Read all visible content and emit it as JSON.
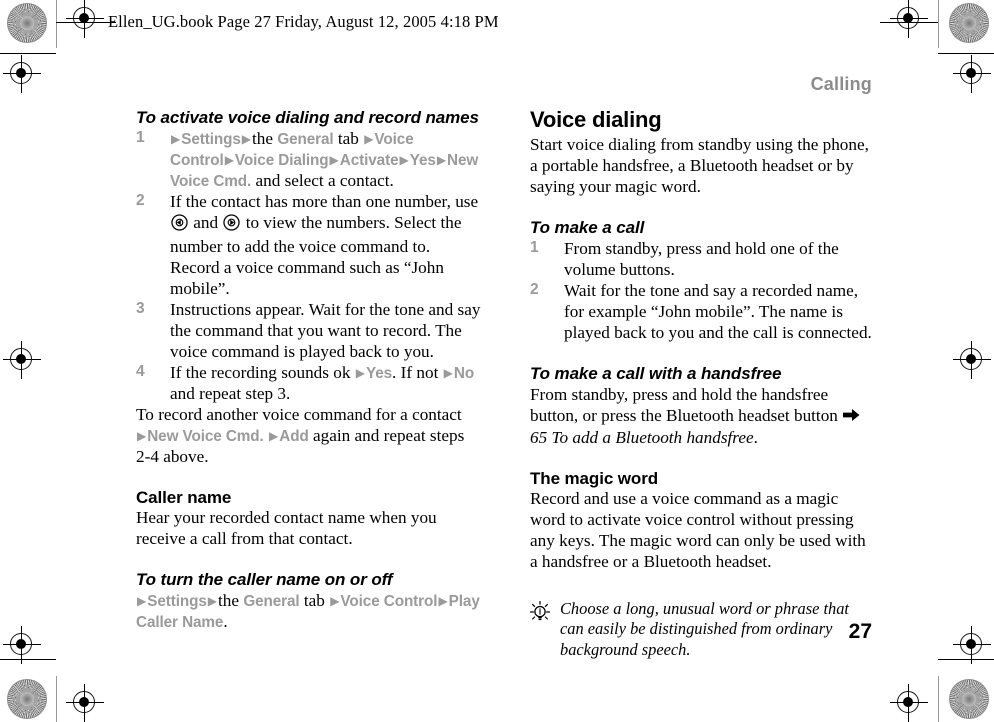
{
  "print_slug": "Ellen_UG.book  Page 27  Friday, August 12, 2005  4:18 PM",
  "running_head": "Calling",
  "page_number": "27",
  "colors": {
    "menu_gray": "#9a9a9a",
    "runhead_gray": "#8c8c8c",
    "text_black": "#000000"
  },
  "left_column": {
    "procedure_1": {
      "heading": "To activate voice dialing and record names",
      "steps": [
        {
          "number": "1",
          "segments": [
            {
              "type": "arrow"
            },
            {
              "type": "menu",
              "text": "Settings"
            },
            {
              "type": "arrow"
            },
            {
              "type": "text",
              "text": "the "
            },
            {
              "type": "menu",
              "text": "General"
            },
            {
              "type": "text",
              "text": " tab "
            },
            {
              "type": "arrow"
            },
            {
              "type": "menu",
              "text": "Voice Control"
            },
            {
              "type": "arrow"
            },
            {
              "type": "menu",
              "text": "Voice Dialing"
            },
            {
              "type": "arrow"
            },
            {
              "type": "menu",
              "text": "Activate"
            },
            {
              "type": "arrow"
            },
            {
              "type": "menu",
              "text": "Yes"
            },
            {
              "type": "arrow"
            },
            {
              "type": "menu",
              "text": "New Voice Cmd."
            },
            {
              "type": "text",
              "text": " and select a contact."
            }
          ]
        },
        {
          "number": "2",
          "segments": [
            {
              "type": "text",
              "text": "If the contact has more than one number, use "
            },
            {
              "type": "navkey",
              "direction": "left"
            },
            {
              "type": "text",
              "text": " and "
            },
            {
              "type": "navkey",
              "direction": "right"
            },
            {
              "type": "text",
              "text": " to view the numbers. Select the number to add the voice command to. Record a voice command such as “John mobile”."
            }
          ]
        },
        {
          "number": "3",
          "segments": [
            {
              "type": "text",
              "text": "Instructions appear. Wait for the tone and say the command that you want to record. The voice command is played back to you."
            }
          ]
        },
        {
          "number": "4",
          "segments": [
            {
              "type": "text",
              "text": "If the recording sounds ok "
            },
            {
              "type": "arrow"
            },
            {
              "type": "menu",
              "text": "Yes"
            },
            {
              "type": "text",
              "text": ". If not "
            },
            {
              "type": "arrow"
            },
            {
              "type": "menu",
              "text": "No"
            },
            {
              "type": "text",
              "text": " and repeat step 3."
            }
          ]
        }
      ],
      "closing_paragraph": [
        {
          "type": "text",
          "text": "To record another voice command for a contact "
        },
        {
          "type": "arrow"
        },
        {
          "type": "menu",
          "text": "New Voice Cmd."
        },
        {
          "type": "text",
          "text": " "
        },
        {
          "type": "arrow"
        },
        {
          "type": "menu",
          "text": "Add"
        },
        {
          "type": "text",
          "text": " again and repeat steps 2-4 above."
        }
      ]
    },
    "caller_name": {
      "heading": "Caller name",
      "body": "Hear your recorded contact name when you receive a call from that contact."
    },
    "procedure_2": {
      "heading": "To turn the caller name on or off",
      "segments": [
        {
          "type": "arrow"
        },
        {
          "type": "menu",
          "text": "Settings"
        },
        {
          "type": "arrow"
        },
        {
          "type": "text",
          "text": "the "
        },
        {
          "type": "menu",
          "text": "General"
        },
        {
          "type": "text",
          "text": " tab "
        },
        {
          "type": "arrow"
        },
        {
          "type": "menu",
          "text": "Voice Control"
        },
        {
          "type": "arrow"
        },
        {
          "type": "menu",
          "text": "Play Caller Name"
        },
        {
          "type": "text",
          "text": "."
        }
      ]
    }
  },
  "right_column": {
    "voice_dialing": {
      "heading": "Voice dialing",
      "body": "Start voice dialing from standby using the phone, a portable handsfree, a Bluetooth headset or by saying your magic word."
    },
    "make_a_call": {
      "heading": "To make a call",
      "steps": [
        {
          "number": "1",
          "text": "From standby, press and hold one of the volume buttons."
        },
        {
          "number": "2",
          "text": "Wait for the tone and say a recorded name, for example “John mobile”. The name is played back to you and the call is connected."
        }
      ]
    },
    "handsfree": {
      "heading": "To make a call with a handsfree",
      "segments": [
        {
          "type": "text",
          "text": "From standby, press and hold the handsfree button, or press the Bluetooth headset button "
        },
        {
          "type": "xref_arrow"
        },
        {
          "type": "xref",
          "text": " 65 To add a Bluetooth handsfree"
        },
        {
          "type": "text",
          "text": "."
        }
      ]
    },
    "magic_word": {
      "heading": "The magic word",
      "body": "Record and use a voice command as a magic word to activate voice control without pressing any keys. The magic word can only be used with a handsfree or a Bluetooth headset."
    },
    "tip": {
      "icon": "lightbulb-icon",
      "text": "Choose a long, unusual word or phrase that can easily be distinguished from ordinary background speech."
    }
  }
}
